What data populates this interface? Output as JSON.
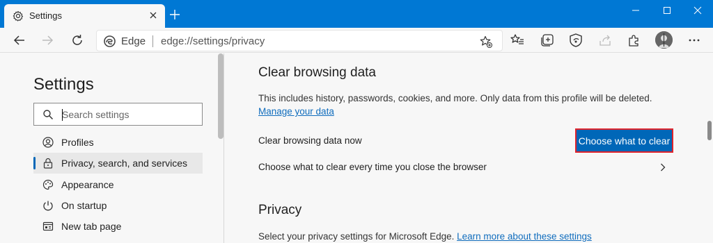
{
  "browser": {
    "tab": {
      "title": "Settings"
    },
    "address": {
      "site_label": "Edge",
      "url": "edge://settings/privacy"
    }
  },
  "sidebar": {
    "title": "Settings",
    "search": {
      "placeholder": "Search settings",
      "value": ""
    },
    "items": [
      {
        "label": "Profiles",
        "icon": "profiles-icon"
      },
      {
        "label": "Privacy, search, and services",
        "icon": "lock-icon",
        "active": true
      },
      {
        "label": "Appearance",
        "icon": "appearance-icon"
      },
      {
        "label": "On startup",
        "icon": "power-icon"
      },
      {
        "label": "New tab page",
        "icon": "new-tab-page-icon"
      }
    ]
  },
  "main": {
    "clear_section": {
      "title": "Clear browsing data",
      "description": "This includes history, passwords, cookies, and more. Only data from this profile will be deleted.",
      "manage_link": "Manage your data",
      "now_label": "Clear browsing data now",
      "button_label": "Choose what to clear",
      "on_close_label": "Choose what to clear every time you close the browser"
    },
    "privacy_section": {
      "title": "Privacy",
      "description": "Select your privacy settings for Microsoft Edge.",
      "learn_more_link": "Learn more about these settings"
    }
  },
  "colors": {
    "titlebar": "#0078d4",
    "primary_button": "#0067b8",
    "highlight_border": "#e0242c",
    "link": "#0f6cbd"
  }
}
